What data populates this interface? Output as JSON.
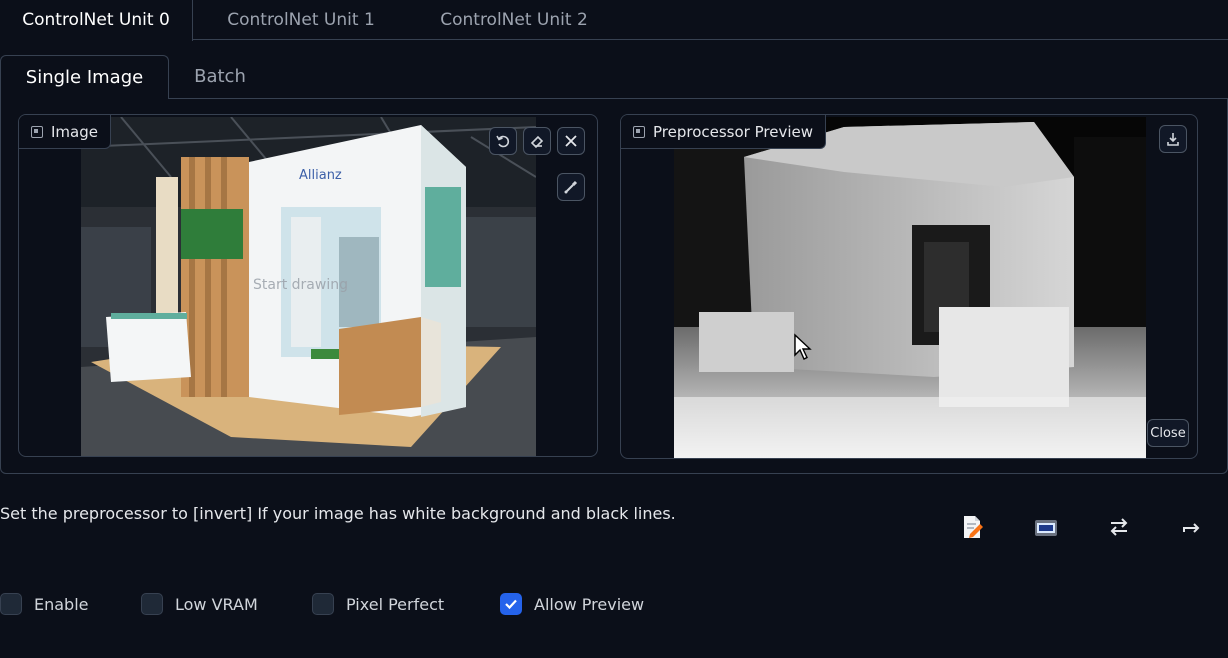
{
  "unit_tabs": [
    "ControlNet Unit 0",
    "ControlNet Unit 1",
    "ControlNet Unit 2"
  ],
  "mode_tabs": [
    "Single Image",
    "Batch"
  ],
  "image_panel": {
    "label": "Image",
    "overlay_text": "Start drawing",
    "booth_sign": "Allianz",
    "buttons": [
      "undo-icon",
      "eraser-icon",
      "close-icon",
      "brush-icon"
    ]
  },
  "preview_panel": {
    "label": "Preprocessor Preview",
    "download_icon": "download-icon",
    "close_label": "Close"
  },
  "hint_text": "Set the preprocessor to [invert] If your image has white background and black lines.",
  "tools": [
    "document-edit-icon",
    "camera-icon",
    "swap-icon",
    "send-icon"
  ],
  "checkboxes": [
    {
      "label": "Enable",
      "checked": false
    },
    {
      "label": "Low VRAM",
      "checked": false
    },
    {
      "label": "Pixel Perfect",
      "checked": false
    },
    {
      "label": "Allow Preview",
      "checked": true
    }
  ],
  "colors": {
    "background": "#0b0f19",
    "border": "#374151",
    "accent": "#2563eb"
  }
}
